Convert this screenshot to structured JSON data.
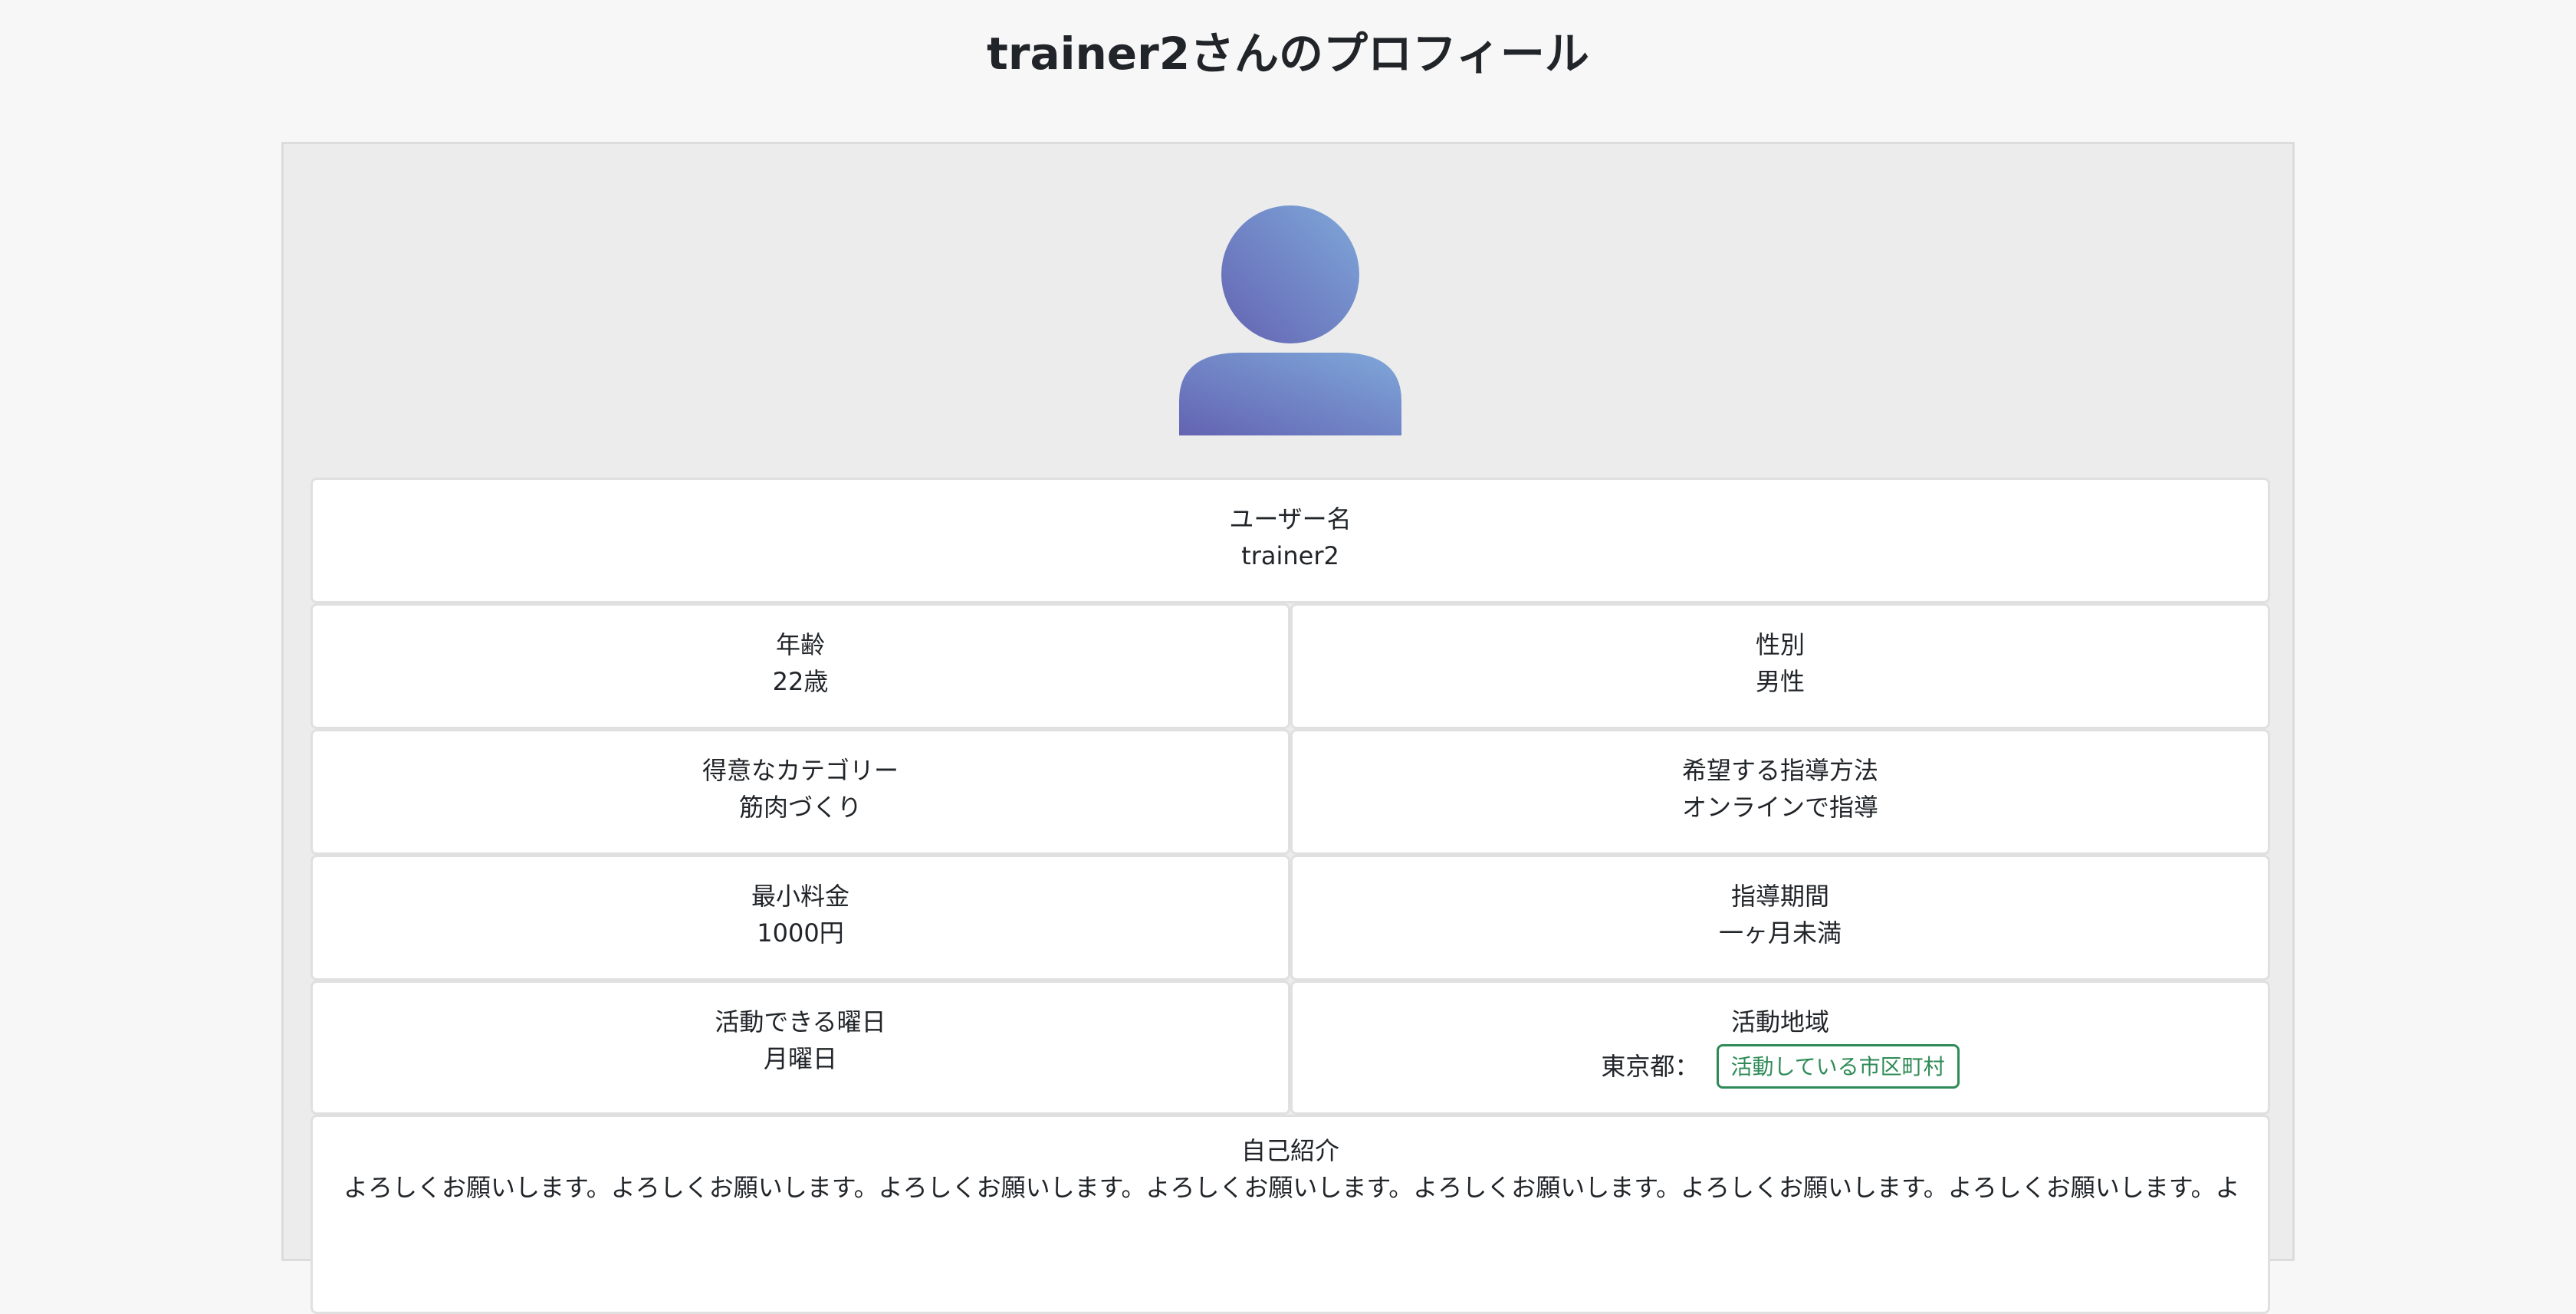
{
  "page": {
    "title": "trainer2さんのプロフィール"
  },
  "avatar": {
    "icon": "user-silhouette-icon",
    "gradient_start": "#6b6bb5",
    "gradient_end": "#7aa3d8"
  },
  "profile": {
    "username": {
      "label": "ユーザー名",
      "value": "trainer2"
    },
    "age": {
      "label": "年齢",
      "value": "22歳"
    },
    "gender": {
      "label": "性別",
      "value": "男性"
    },
    "category": {
      "label": "得意なカテゴリー",
      "value": "筋肉づくり"
    },
    "method": {
      "label": "希望する指導方法",
      "value": "オンラインで指導"
    },
    "min_fee": {
      "label": "最小料金",
      "value": "1000円"
    },
    "period": {
      "label": "指導期間",
      "value": "一ヶ月未満"
    },
    "days": {
      "label": "活動できる曜日",
      "value": "月曜日"
    },
    "area": {
      "label": "活動地域",
      "prefecture": "東京都：",
      "city_button": "活動している市区町村"
    },
    "intro": {
      "label": "自己紹介",
      "text": "よろしくお願いします。よろしくお願いします。よろしくお願いします。よろしくお願いします。よろしくお願いします。よろしくお願いします。よろしくお願いします。よ"
    }
  },
  "colors": {
    "background": "#f7f7f7",
    "card": "#ececec",
    "cell": "#ffffff",
    "accent_green": "#2e8b57"
  }
}
